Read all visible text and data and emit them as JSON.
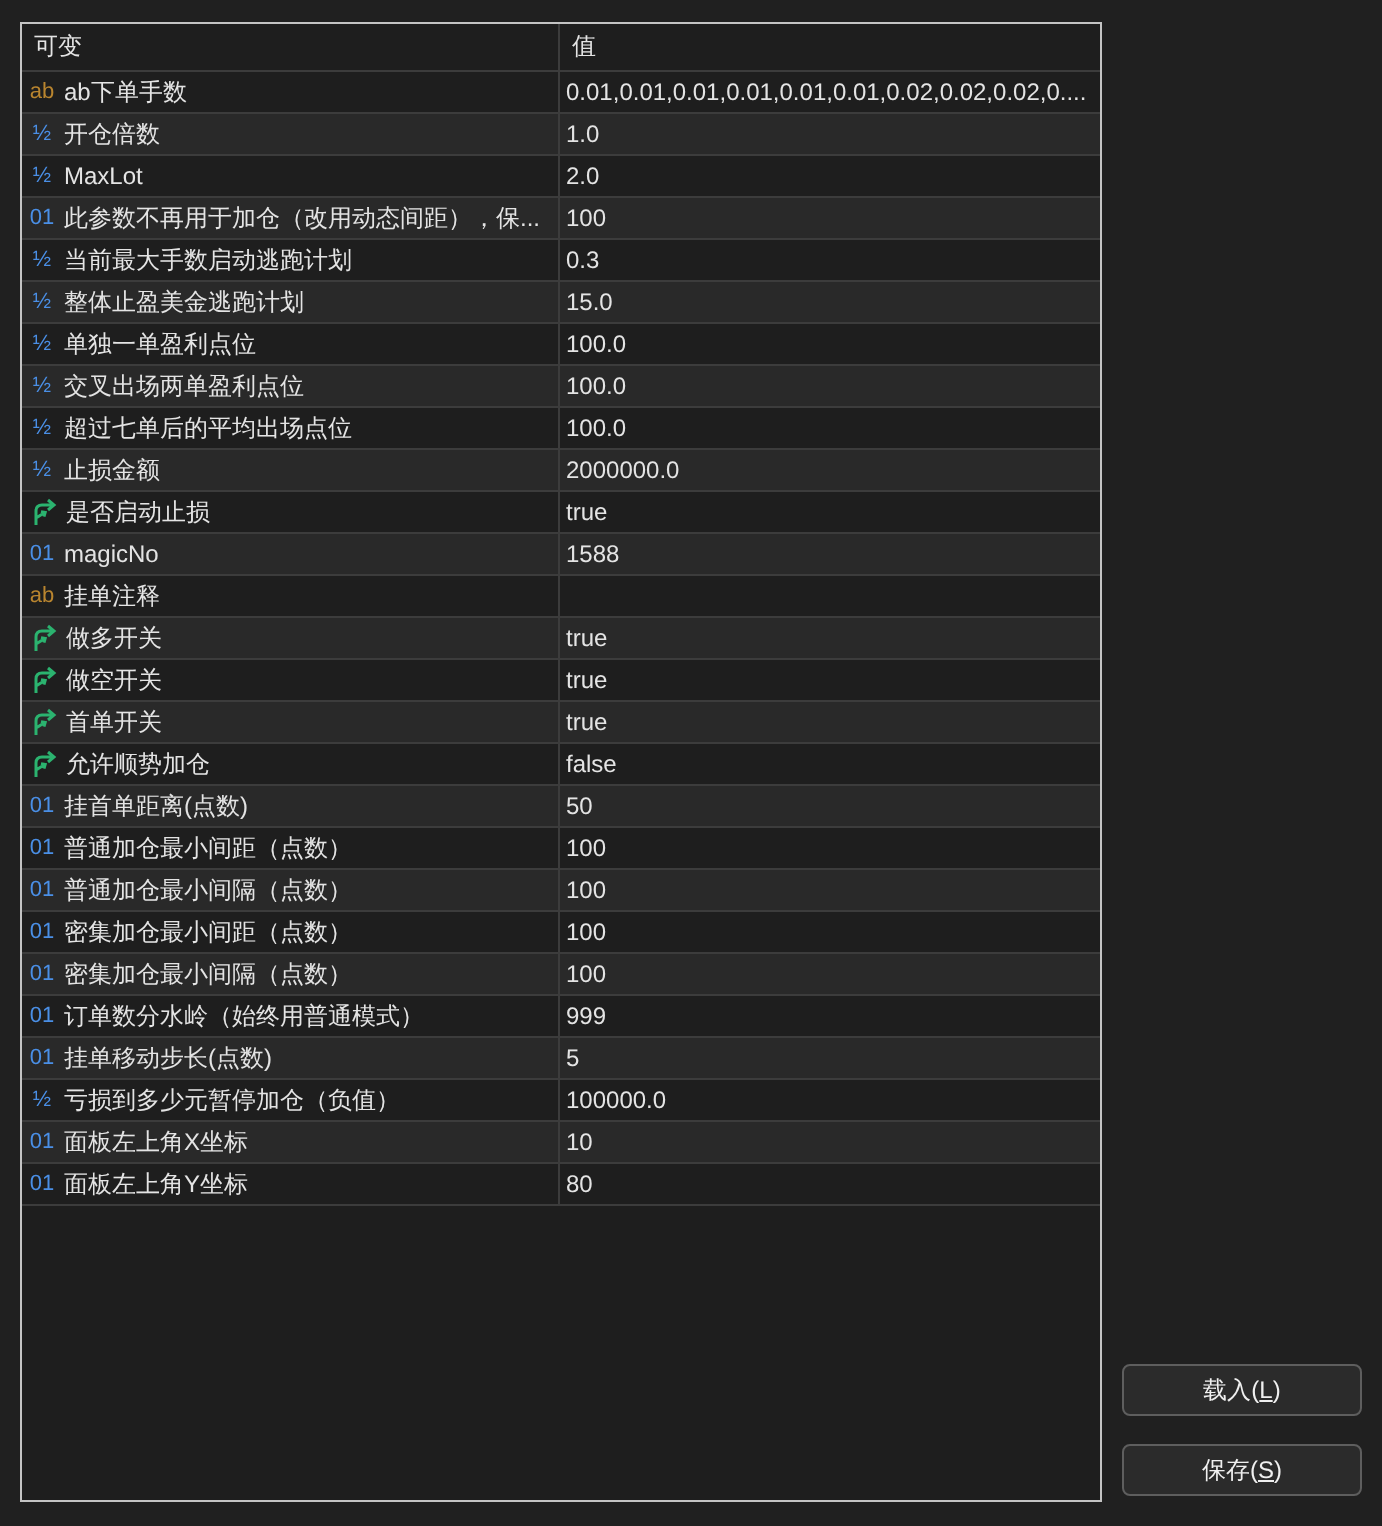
{
  "columns": [
    {
      "label": "可变"
    },
    {
      "label": "值"
    }
  ],
  "rows": [
    {
      "kind": "string",
      "icon": "ab",
      "name": "ab下单手数",
      "value": "0.01,0.01,0.01,0.01,0.01,0.01,0.02,0.02,0.02,0...."
    },
    {
      "kind": "double",
      "icon": "½",
      "name": "开仓倍数",
      "value": "1.0"
    },
    {
      "kind": "double",
      "icon": "½",
      "name": "MaxLot",
      "value": "2.0"
    },
    {
      "kind": "int",
      "icon": "01",
      "name": "此参数不再用于加仓（改用动态间距），保...",
      "value": "100"
    },
    {
      "kind": "double",
      "icon": "½",
      "name": "当前最大手数启动逃跑计划",
      "value": "0.3"
    },
    {
      "kind": "double",
      "icon": "½",
      "name": "整体止盈美金逃跑计划",
      "value": "15.0"
    },
    {
      "kind": "double",
      "icon": "½",
      "name": "单独一单盈利点位",
      "value": "100.0"
    },
    {
      "kind": "double",
      "icon": "½",
      "name": "交叉出场两单盈利点位",
      "value": "100.0"
    },
    {
      "kind": "double",
      "icon": "½",
      "name": "超过七单后的平均出场点位",
      "value": "100.0"
    },
    {
      "kind": "double",
      "icon": "½",
      "name": "止损金额",
      "value": "2000000.0"
    },
    {
      "kind": "bool",
      "name": "是否启动止损",
      "value": "true"
    },
    {
      "kind": "int",
      "icon": "01",
      "name": "magicNo",
      "value": "1588"
    },
    {
      "kind": "string",
      "icon": "ab",
      "name": "挂单注释"
    },
    {
      "kind": "bool",
      "name": "做多开关",
      "value": "true"
    },
    {
      "kind": "bool",
      "name": "做空开关",
      "value": "true"
    },
    {
      "kind": "bool",
      "name": "首单开关",
      "value": "true"
    },
    {
      "kind": "bool",
      "name": "允许顺势加仓",
      "value": "false"
    },
    {
      "kind": "int",
      "icon": "01",
      "name": "挂首单距离(点数)",
      "value": "50"
    },
    {
      "kind": "int",
      "icon": "01",
      "name": "普通加仓最小间距（点数）",
      "value": "100"
    },
    {
      "kind": "int",
      "icon": "01",
      "name": "普通加仓最小间隔（点数）",
      "value": "100"
    },
    {
      "kind": "int",
      "icon": "01",
      "name": "密集加仓最小间距（点数）",
      "value": "100"
    },
    {
      "kind": "int",
      "icon": "01",
      "name": "密集加仓最小间隔（点数）",
      "value": "100"
    },
    {
      "kind": "int",
      "icon": "01",
      "name": "订单数分水岭（始终用普通模式）",
      "value": "999"
    },
    {
      "kind": "int",
      "icon": "01",
      "name": "挂单移动步长(点数)",
      "value": "5"
    },
    {
      "kind": "double",
      "icon": "½",
      "name": "亏损到多少元暂停加仓（负值）",
      "value": "100000.0"
    },
    {
      "kind": "int",
      "icon": "01",
      "name": "面板左上角X坐标",
      "value": "10"
    },
    {
      "kind": "int",
      "icon": "01",
      "name": "面板左上角Y坐标",
      "value": "80"
    }
  ],
  "buttons": [
    {
      "text": "载入(",
      "access_key": "L",
      "text_after": ")"
    },
    {
      "text": "保存(",
      "access_key": "S",
      "text_after": ")"
    }
  ]
}
